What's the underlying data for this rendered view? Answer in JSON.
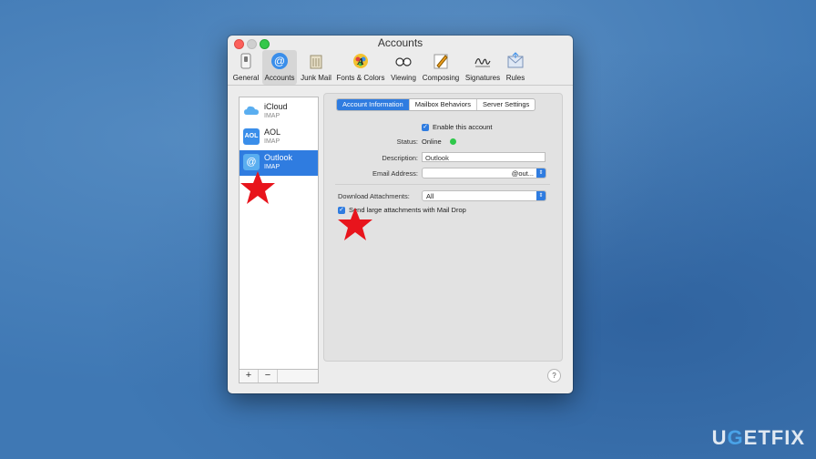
{
  "window": {
    "title": "Accounts"
  },
  "toolbar": {
    "items": [
      {
        "label": "General",
        "icon": "switch-icon"
      },
      {
        "label": "Accounts",
        "icon": "at-sign-icon",
        "active": true
      },
      {
        "label": "Junk Mail",
        "icon": "trash-icon"
      },
      {
        "label": "Fonts & Colors",
        "icon": "font-palette-icon"
      },
      {
        "label": "Viewing",
        "icon": "glasses-icon"
      },
      {
        "label": "Composing",
        "icon": "pencil-icon"
      },
      {
        "label": "Signatures",
        "icon": "signature-icon"
      },
      {
        "label": "Rules",
        "icon": "envelope-icon"
      }
    ]
  },
  "sidebar": {
    "accounts": [
      {
        "name": "iCloud",
        "type": "IMAP",
        "icon": "cloud-icon"
      },
      {
        "name": "AOL",
        "type": "IMAP",
        "icon": "aol-icon",
        "icon_text": "AOL"
      },
      {
        "name": "Outlook",
        "type": "IMAP",
        "icon": "at-sign-icon",
        "icon_text": "@",
        "selected": true
      }
    ],
    "add": "+",
    "remove": "−"
  },
  "tabs": [
    "Account Information",
    "Mailbox Behaviors",
    "Server Settings"
  ],
  "form": {
    "enable_label": "Enable this account",
    "status_label": "Status:",
    "status_value": "Online",
    "description_label": "Description:",
    "description_value": "Outlook",
    "email_label": "Email Address:",
    "email_value": "@out...",
    "download_label": "Download Attachments:",
    "download_value": "All",
    "maildrop_label": "Send large attachments with Mail Drop"
  },
  "help": "?",
  "watermark": {
    "pre": "U",
    "accent": "G",
    "post": "ETFIX"
  },
  "colors": {
    "accent": "#2f7ce0",
    "online": "#2ec84a",
    "star": "#e8141c"
  }
}
